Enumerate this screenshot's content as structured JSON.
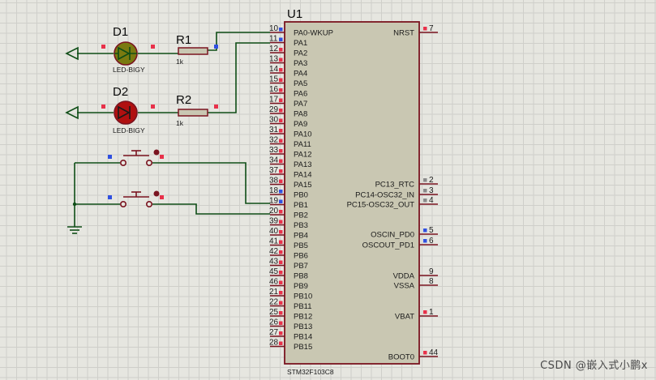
{
  "mcu": {
    "ref": "U1",
    "part": "STM32F103C8",
    "left_pins": [
      {
        "num": "10",
        "name": "PA0-WKUP"
      },
      {
        "num": "11",
        "name": "PA1"
      },
      {
        "num": "12",
        "name": "PA2"
      },
      {
        "num": "13",
        "name": "PA3"
      },
      {
        "num": "14",
        "name": "PA4"
      },
      {
        "num": "15",
        "name": "PA5"
      },
      {
        "num": "16",
        "name": "PA6"
      },
      {
        "num": "17",
        "name": "PA7"
      },
      {
        "num": "29",
        "name": "PA8"
      },
      {
        "num": "30",
        "name": "PA9"
      },
      {
        "num": "31",
        "name": "PA10"
      },
      {
        "num": "32",
        "name": "PA11"
      },
      {
        "num": "33",
        "name": "PA12"
      },
      {
        "num": "34",
        "name": "PA13"
      },
      {
        "num": "37",
        "name": "PA14"
      },
      {
        "num": "38",
        "name": "PA15"
      },
      {
        "num": "18",
        "name": "PB0"
      },
      {
        "num": "19",
        "name": "PB1"
      },
      {
        "num": "20",
        "name": "PB2"
      },
      {
        "num": "39",
        "name": "PB3"
      },
      {
        "num": "40",
        "name": "PB4"
      },
      {
        "num": "41",
        "name": "PB5"
      },
      {
        "num": "42",
        "name": "PB6"
      },
      {
        "num": "43",
        "name": "PB7"
      },
      {
        "num": "45",
        "name": "PB8"
      },
      {
        "num": "46",
        "name": "PB9"
      },
      {
        "num": "21",
        "name": "PB10"
      },
      {
        "num": "22",
        "name": "PB11"
      },
      {
        "num": "25",
        "name": "PB12"
      },
      {
        "num": "26",
        "name": "PB13"
      },
      {
        "num": "27",
        "name": "PB14"
      },
      {
        "num": "28",
        "name": "PB15"
      }
    ],
    "right_pins": [
      {
        "num": "7",
        "name": "NRST"
      },
      {
        "num": "2",
        "name": "PC13_RTC"
      },
      {
        "num": "3",
        "name": "PC14-OSC32_IN"
      },
      {
        "num": "4",
        "name": "PC15-OSC32_OUT"
      },
      {
        "num": "5",
        "name": "OSCIN_PD0"
      },
      {
        "num": "6",
        "name": "OSCOUT_PD1"
      },
      {
        "num": "9",
        "name": "VDDA"
      },
      {
        "num": "8",
        "name": "VSSA"
      },
      {
        "num": "1",
        "name": "VBAT"
      },
      {
        "num": "44",
        "name": "BOOT0"
      }
    ]
  },
  "d1": {
    "ref": "D1",
    "part": "LED-BIGY"
  },
  "d2": {
    "ref": "D2",
    "part": "LED-BIGY"
  },
  "r1": {
    "ref": "R1",
    "value": "1k"
  },
  "r2": {
    "ref": "R2",
    "value": "1k"
  },
  "watermark": "CSDN @嵌入式小鹏x",
  "colors": {
    "wire": "#0e4d16",
    "body": "#c9c7b2",
    "outline": "#7a1420",
    "pin": "#7a1420",
    "led1": "#7a7a10",
    "led2": "#b01010",
    "red_marker": "#e8314a",
    "blue_marker": "#3050e0"
  }
}
